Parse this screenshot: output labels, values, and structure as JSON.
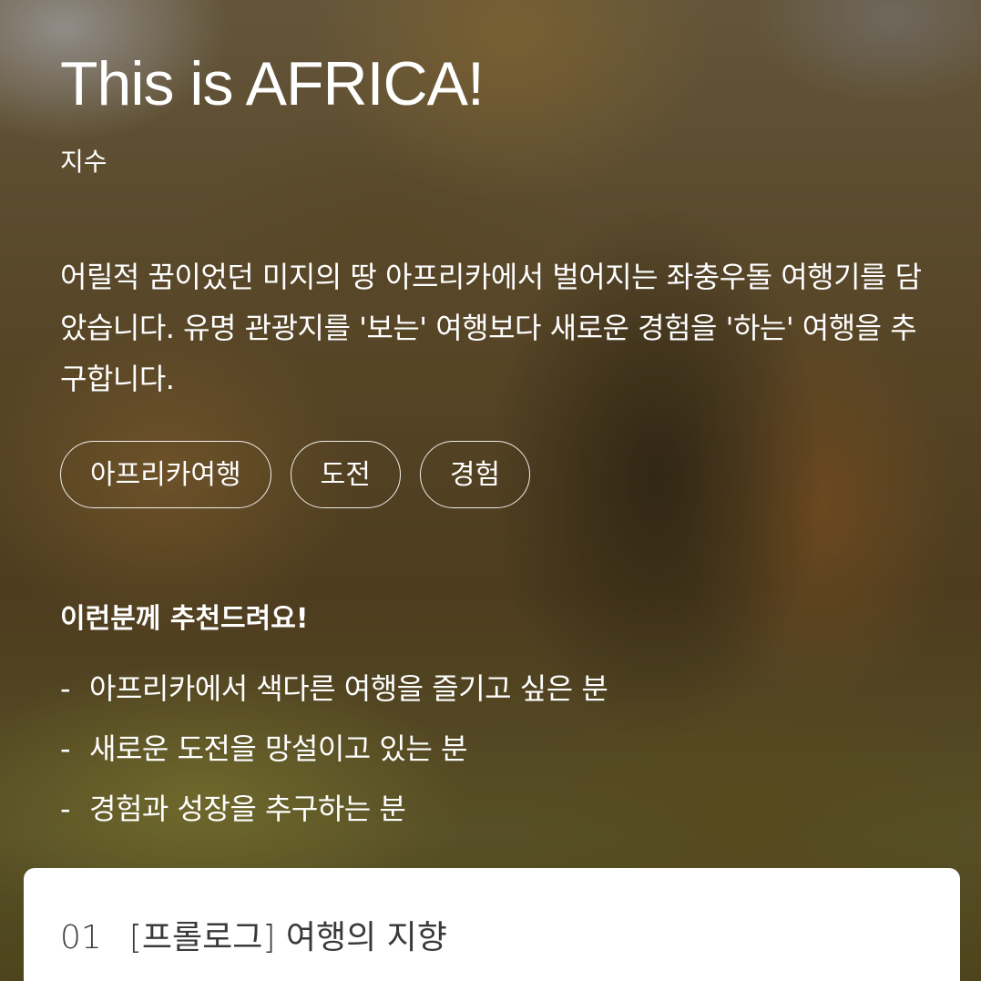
{
  "header": {
    "title": "This is AFRICA!",
    "author": "지수"
  },
  "description": "어릴적 꿈이었던 미지의 땅 아프리카에서 벌어지는 좌충우돌 여행기를 담았습니다. 유명 관광지를 '보는' 여행보다 새로운 경험을 '하는' 여행을 추구합니다.",
  "tags": [
    "아프리카여행",
    "도전",
    "경험"
  ],
  "recommend": {
    "heading": "이런분께 추천드려요!",
    "dash": "-",
    "items": [
      "아프리카에서 색다른 여행을 즐기고 싶은 분",
      "새로운 도전을 망설이고 있는 분",
      "경험과 성장을 추구하는 분"
    ]
  },
  "chapter": {
    "number": "01",
    "title": "[프롤로그] 여행의 지향"
  }
}
